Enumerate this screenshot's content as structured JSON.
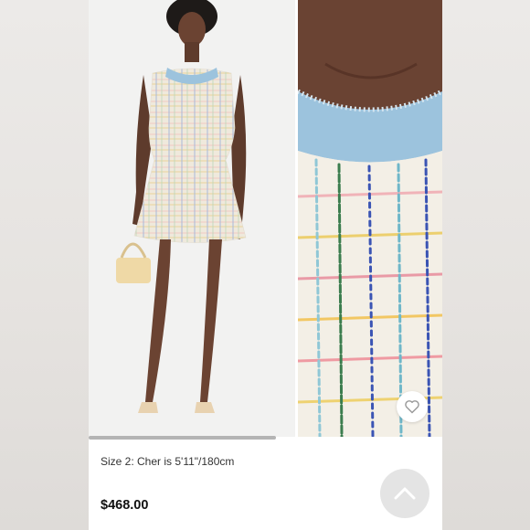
{
  "product": {
    "size_caption": "Size 2: Cher is 5'11\"/180cm",
    "price": "$468.00"
  },
  "icons": {
    "favorite": "heart-icon",
    "scroll_top": "chevron-up-icon"
  },
  "colors": {
    "denim_trim": "#9cc3dd",
    "tweed_base": "#f1ecdf",
    "price_text": "#111111",
    "button_bg": "#e4e4e4"
  }
}
